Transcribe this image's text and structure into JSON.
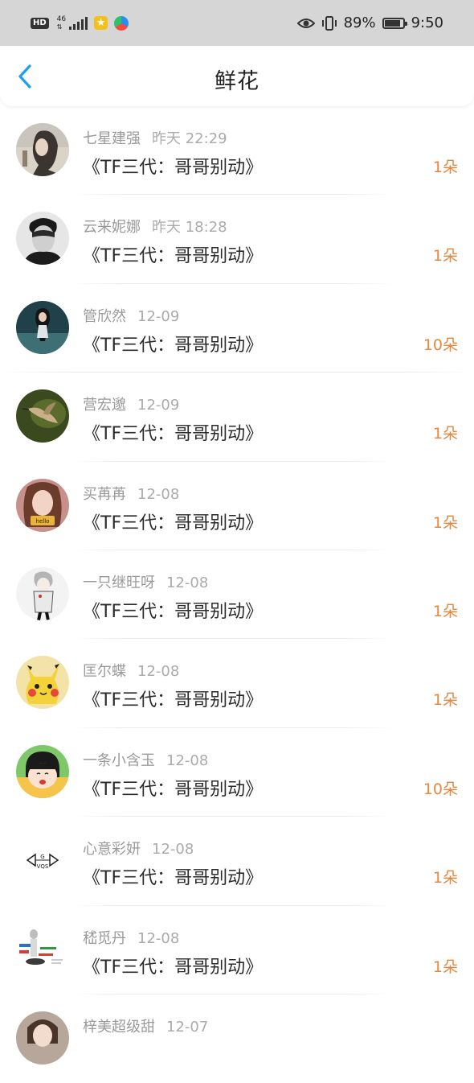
{
  "status_bar": {
    "hd": "HD",
    "network": "46",
    "battery_percent": "89%",
    "battery_level": 0.89,
    "time": "9:50"
  },
  "header": {
    "title": "鲜花",
    "back_icon": "chevron-left-icon",
    "accent": "#1e9df2"
  },
  "colors": {
    "count": "#e5883d",
    "meta": "#9a9a9a"
  },
  "records": [
    {
      "user": "七星建强",
      "time": "昨天 22:29",
      "book": "《TF三代：哥哥别动》",
      "count": "1朵"
    },
    {
      "user": "云来妮娜",
      "time": "昨天 18:28",
      "book": "《TF三代：哥哥别动》",
      "count": "1朵"
    },
    {
      "user": "管欣然",
      "time": "12-09",
      "book": "《TF三代：哥哥别动》",
      "count": "10朵"
    },
    {
      "user": "营宏邈",
      "time": "12-09",
      "book": "《TF三代：哥哥别动》",
      "count": "1朵"
    },
    {
      "user": "买苒苒",
      "time": "12-08",
      "book": "《TF三代：哥哥别动》",
      "count": "1朵"
    },
    {
      "user": "一只继旺呀",
      "time": "12-08",
      "book": "《TF三代：哥哥别动》",
      "count": "1朵"
    },
    {
      "user": "匡尔蝶",
      "time": "12-08",
      "book": "《TF三代：哥哥别动》",
      "count": "1朵"
    },
    {
      "user": "一条小含玉",
      "time": "12-08",
      "book": "《TF三代：哥哥别动》",
      "count": "10朵"
    },
    {
      "user": "心意彩妍",
      "time": "12-08",
      "book": "《TF三代：哥哥别动》",
      "count": "1朵"
    },
    {
      "user": "嵇觅丹",
      "time": "12-08",
      "book": "《TF三代：哥哥别动》",
      "count": "1朵"
    },
    {
      "user": "梓美超级甜",
      "time": "12-07",
      "book": "",
      "count": ""
    }
  ],
  "avatar_texts": {
    "r4": "hello",
    "r8_top": "G",
    "r8_bottom": "VQS"
  }
}
